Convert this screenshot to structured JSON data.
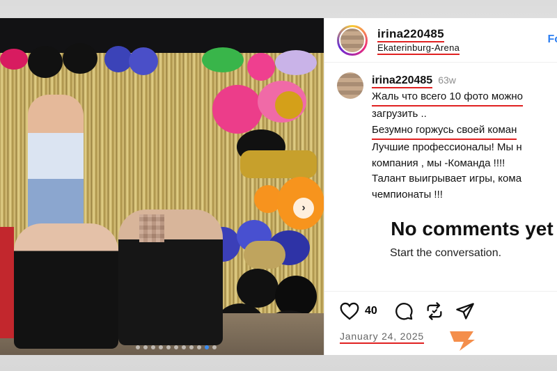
{
  "post": {
    "username": "irina220485",
    "location": "Ekaterinburg-Arena",
    "follow_label": "Fo",
    "caption_user": "irina220485",
    "caption_age": "63w",
    "caption_lines": [
      "Жаль что всего 10 фото можно",
      "загрузить ..",
      "Безумно горжусь своей коман",
      "Лучшие профессионалы! Мы н",
      "компания , мы -Команда !!!!",
      "Талант выигрывает игры, кома",
      "чемпионаты !!!"
    ],
    "no_comments_title": "No comments yet",
    "no_comments_sub": "Start the conversation.",
    "likes": "40",
    "date": "January 24, 2025"
  },
  "carousel": {
    "current_index": 10,
    "total": 11
  },
  "colors": {
    "underline": "#e02020",
    "accent": "#2d7ff2"
  }
}
